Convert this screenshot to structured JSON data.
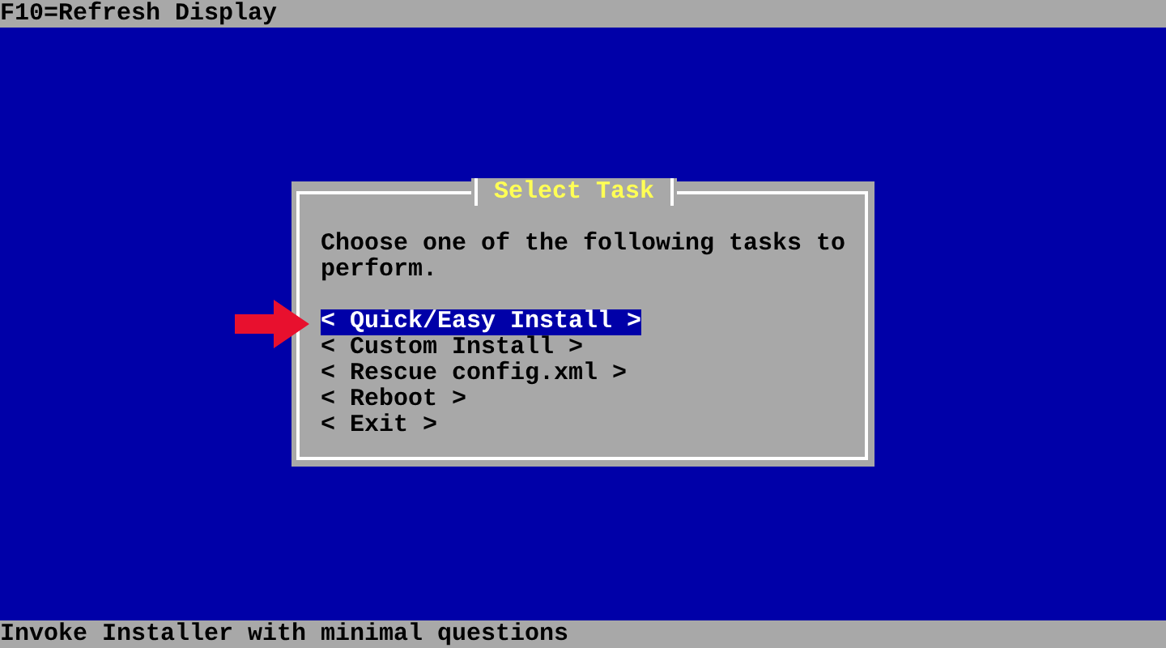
{
  "top_bar": {
    "text": "F10=Refresh Display"
  },
  "dialog": {
    "title": "Select Task",
    "message": "Choose one of the following tasks to perform.",
    "options": [
      {
        "label": "< Quick/Easy Install >",
        "selected": true
      },
      {
        "label": "< Custom Install >",
        "selected": false
      },
      {
        "label": "< Rescue config.xml >",
        "selected": false
      },
      {
        "label": "< Reboot >",
        "selected": false
      },
      {
        "label": "< Exit >",
        "selected": false
      }
    ]
  },
  "status_bar": {
    "text": "Invoke Installer with minimal questions"
  }
}
